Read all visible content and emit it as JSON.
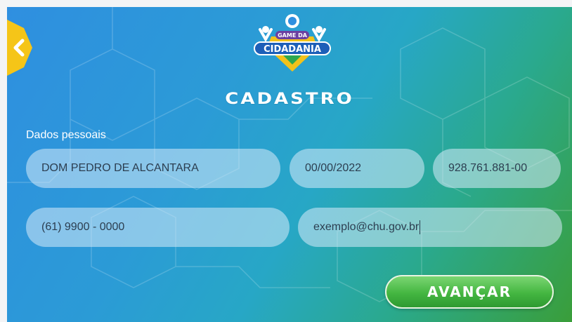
{
  "header": {
    "logo_text_top": "GAME DA",
    "logo_text_bottom": "CIDADANIA",
    "title": "CADASTRO"
  },
  "form": {
    "section_label": "Dados pessoais",
    "name": "DOM PEDRO DE ALCANTARA",
    "birthdate": "00/00/2022",
    "cpf": "928.761.881-00",
    "phone": "(61) 9900 - 0000",
    "email": "exemplo@chu.gov.br"
  },
  "actions": {
    "advance_label": "AVANÇAR"
  },
  "icons": {
    "back": "chevron-left-icon"
  },
  "colors": {
    "background_start": "#2f8fe0",
    "background_end": "#3a9e3a",
    "back_button": "#f5c518",
    "advance_button": "#44b641",
    "field_fill": "#d7ebfa"
  }
}
